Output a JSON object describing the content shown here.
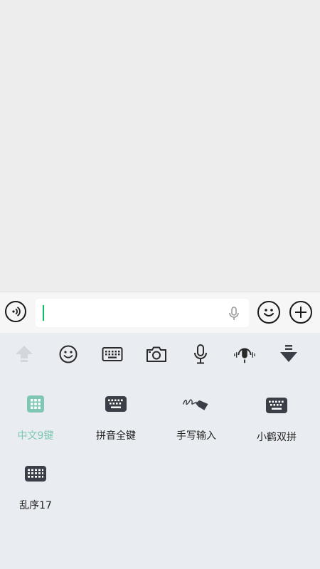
{
  "input_bar": {
    "text_value": "",
    "icons": [
      "voice-icon",
      "microphone-icon",
      "emoji-icon",
      "plus-icon"
    ]
  },
  "keyboard_toolbar": {
    "icons": [
      "shift-up-arrow-icon",
      "emoji-icon",
      "keyboard-icon",
      "camera-icon",
      "microphone-icon",
      "podcast-icon",
      "hide-keyboard-icon"
    ]
  },
  "layouts": [
    {
      "label": "中文9键",
      "icon": "numpad-grid-icon",
      "selected": true
    },
    {
      "label": "拼音全键",
      "icon": "full-keyboard-icon",
      "selected": false
    },
    {
      "label": "手写输入",
      "icon": "handwriting-pen-icon",
      "selected": false
    },
    {
      "label": "小鹤双拼",
      "icon": "full-keyboard-icon",
      "selected": false
    },
    {
      "label": "乱序17",
      "icon": "compact-keyboard-icon",
      "selected": false
    }
  ],
  "colors": {
    "accent": "#7fc7b4",
    "caret": "#07c160",
    "keyboard_bg": "#e9ecf0",
    "chat_bg": "#ededed",
    "icon_dark": "#3a3f47"
  }
}
